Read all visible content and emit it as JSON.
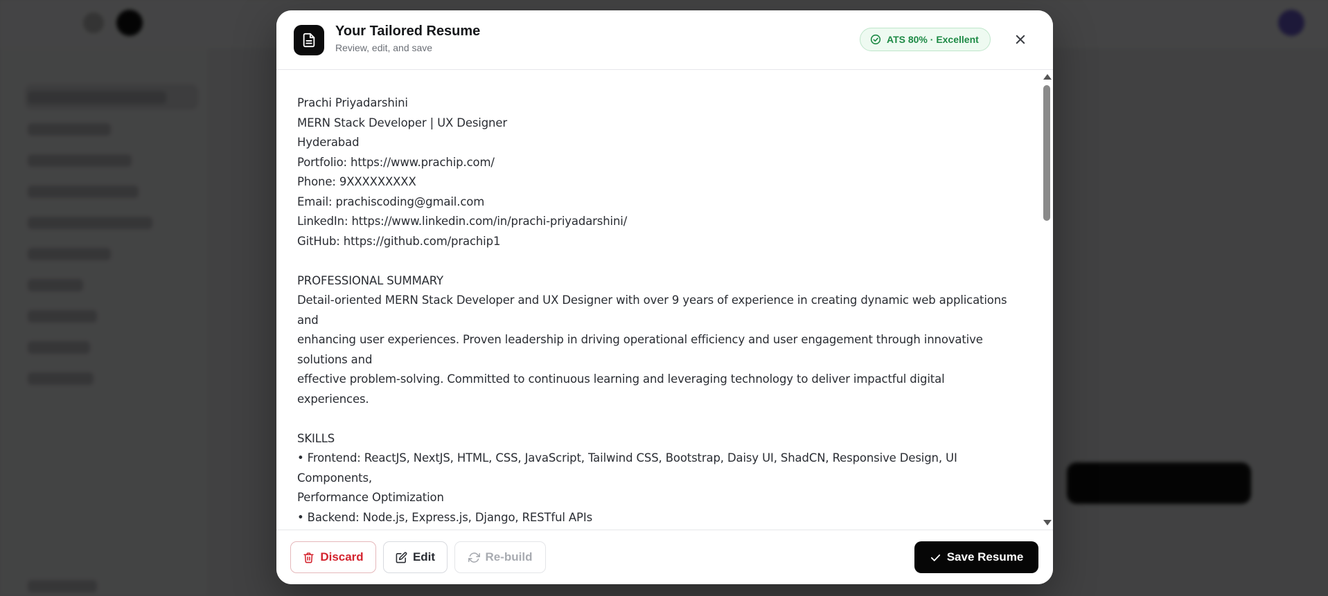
{
  "modal": {
    "title": "Your Tailored Resume",
    "subtitle": "Review, edit, and save",
    "ats_badge": "ATS 80% · Excellent",
    "icons": {
      "document": "document-icon",
      "check": "check-circle-icon",
      "close": "close-icon"
    }
  },
  "resume": {
    "text": "Prachi Priyadarshini\nMERN Stack Developer | UX Designer\nHyderabad\nPortfolio: https://www.prachip.com/\nPhone: 9XXXXXXXXX\nEmail: prachiscoding@gmail.com\nLinkedIn: https://www.linkedin.com/in/prachi-priyadarshini/\nGitHub: https://github.com/prachip1\n\nPROFESSIONAL SUMMARY\nDetail-oriented MERN Stack Developer and UX Designer with over 9 years of experience in creating dynamic web applications and\nenhancing user experiences. Proven leadership in driving operational efficiency and user engagement through innovative solutions and\neffective problem-solving. Committed to continuous learning and leveraging technology to deliver impactful digital experiences.\n\nSKILLS\n• Frontend: ReactJS, NextJS, HTML, CSS, JavaScript, Tailwind CSS, Bootstrap, Daisy UI, ShadCN, Responsive Design, UI Components,\nPerformance Optimization\n• Backend: Node.js, Express.js, Django, RESTful APIs\n• Database: MySQL, Firebase, MongoDB, Supabase\n• Tools: Node, Vite, Git, Vercel, Docker, ServiceNow, Adobe XD, Figma, Jira\n• Soft Skills: Patience, Perseverance, Teamwork, Adaptability, Critical Thinking, Problem-Solving, Customer Focus\n• Technical Skills: API Integration, ServiceNow, Debugging, Collaboration"
  },
  "footer": {
    "discard_label": "Discard",
    "edit_label": "Edit",
    "rebuild_label": "Re-build",
    "save_label": "Save Resume"
  },
  "colors": {
    "accent_success": "#1d8a45",
    "danger": "#d4242f",
    "primary_button": "#060606"
  }
}
